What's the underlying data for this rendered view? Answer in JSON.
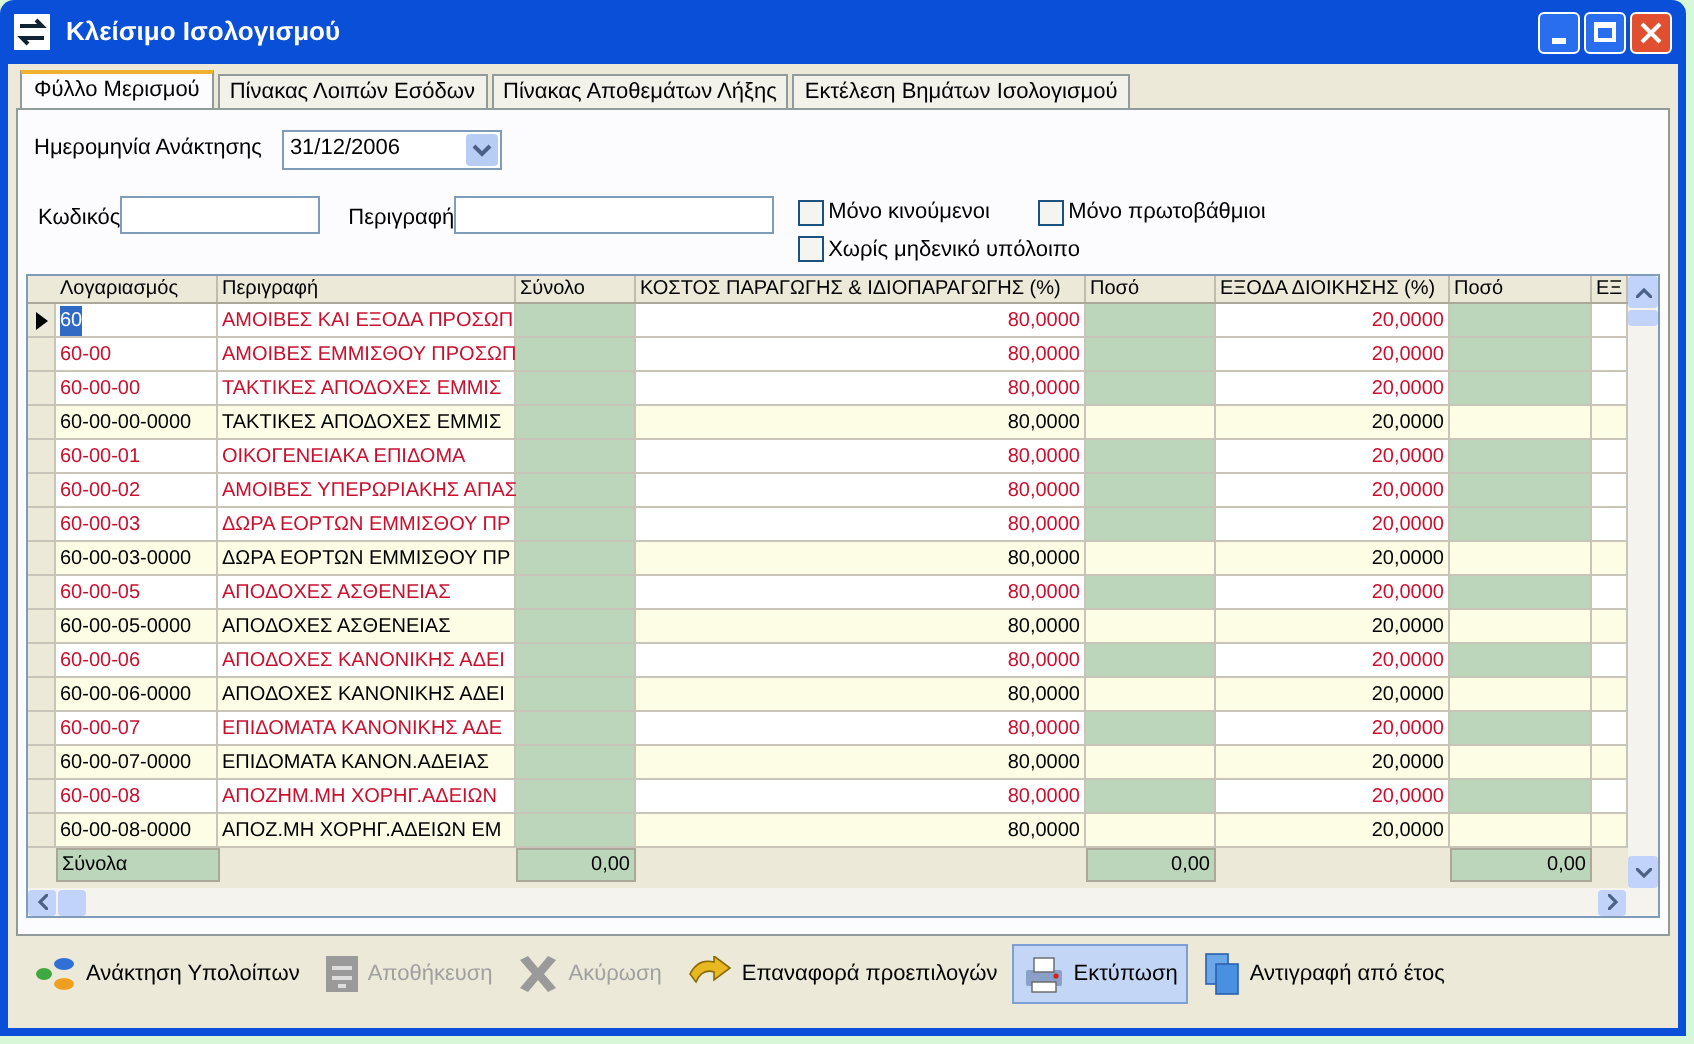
{
  "window": {
    "title": "Κλείσιμο Ισολογισμού"
  },
  "tabs": [
    {
      "label": "Φύλλο Μερισμού",
      "selected": true
    },
    {
      "label": "Πίνακας Λοιπών Εσόδων",
      "selected": false
    },
    {
      "label": "Πίνακας Αποθεμάτων Λήξης",
      "selected": false
    },
    {
      "label": "Εκτέλεση Βημάτων Ισολογισμού",
      "selected": false
    }
  ],
  "date_field": {
    "label": "Ημερομηνία Ανάκτησης",
    "value": "31/12/2006"
  },
  "filters": {
    "code_label": "Κωδικός",
    "description_label": "Περιγραφή",
    "checkboxes": [
      {
        "label": "Μόνο κινούμενοι",
        "checked": false
      },
      {
        "label": "Μόνο πρωτοβάθμιοι",
        "checked": false
      },
      {
        "label": "Χωρίς μηδενικό υπόλοιπο",
        "checked": false
      }
    ]
  },
  "table": {
    "columns": [
      "Λογαριασμός",
      "Περιγραφή",
      "Σύνολο",
      "ΚΟΣΤΟΣ ΠΑΡΑΓΩΓΗΣ & ΙΔΙΟΠΑΡΑΓΩΓΗΣ (%)",
      "Ποσό",
      "ΕΞΟΔΑ ΔΙΟΙΚΗΣΗΣ (%)",
      "Ποσό",
      "ΕΞ"
    ],
    "rows": [
      {
        "kind": "group",
        "selected": true,
        "code": "60",
        "description": "ΑΜΟΙΒΕΣ ΚΑΙ ΕΞΟΔΑ ΠΡΟΣΩΠ",
        "pct_1": "80,0000",
        "pct_2": "20,0000"
      },
      {
        "kind": "group",
        "selected": false,
        "code": "60-00",
        "description": "ΑΜΟΙΒΕΣ ΕΜΜΙΣΘΟΥ ΠΡΟΣΩΠ",
        "pct_1": "80,0000",
        "pct_2": "20,0000"
      },
      {
        "kind": "group",
        "selected": false,
        "code": "60-00-00",
        "description": "ΤΑΚΤΙΚΕΣ ΑΠΟΔΟΧΕΣ ΕΜΜΙΣ",
        "pct_1": "80,0000",
        "pct_2": "20,0000"
      },
      {
        "kind": "account",
        "selected": false,
        "code": "60-00-00-0000",
        "description": "ΤΑΚΤΙΚΕΣ ΑΠΟΔΟΧΕΣ ΕΜΜΙΣ",
        "pct_1": "80,0000",
        "pct_2": "20,0000"
      },
      {
        "kind": "group",
        "selected": false,
        "code": "60-00-01",
        "description": "ΟΙΚΟΓΕΝΕΙΑΚΑ ΕΠΙΔΟΜΑ",
        "pct_1": "80,0000",
        "pct_2": "20,0000"
      },
      {
        "kind": "group",
        "selected": false,
        "code": "60-00-02",
        "description": "ΑΜΟΙΒΕΣ ΥΠΕΡΩΡΙΑΚΗΣ ΑΠΑΣ",
        "pct_1": "80,0000",
        "pct_2": "20,0000"
      },
      {
        "kind": "group",
        "selected": false,
        "code": "60-00-03",
        "description": "ΔΩΡΑ ΕΟΡΤΩΝ ΕΜΜΙΣΘΟΥ ΠΡ",
        "pct_1": "80,0000",
        "pct_2": "20,0000"
      },
      {
        "kind": "account",
        "selected": false,
        "code": "60-00-03-0000",
        "description": "ΔΩΡΑ ΕΟΡΤΩΝ ΕΜΜΙΣΘΟΥ ΠΡ",
        "pct_1": "80,0000",
        "pct_2": "20,0000"
      },
      {
        "kind": "group",
        "selected": false,
        "code": "60-00-05",
        "description": "ΑΠΟΔΟΧΕΣ ΑΣΘΕΝΕΙΑΣ",
        "pct_1": "80,0000",
        "pct_2": "20,0000"
      },
      {
        "kind": "account",
        "selected": false,
        "code": "60-00-05-0000",
        "description": "ΑΠΟΔΟΧΕΣ ΑΣΘΕΝΕΙΑΣ",
        "pct_1": "80,0000",
        "pct_2": "20,0000"
      },
      {
        "kind": "group",
        "selected": false,
        "code": "60-00-06",
        "description": "ΑΠΟΔΟΧΕΣ ΚΑΝΟΝΙΚΗΣ ΑΔΕΙ",
        "pct_1": "80,0000",
        "pct_2": "20,0000"
      },
      {
        "kind": "account",
        "selected": false,
        "code": "60-00-06-0000",
        "description": "ΑΠΟΔΟΧΕΣ ΚΑΝΟΝΙΚΗΣ ΑΔΕΙ",
        "pct_1": "80,0000",
        "pct_2": "20,0000"
      },
      {
        "kind": "group",
        "selected": false,
        "code": "60-00-07",
        "description": "ΕΠΙΔΟΜΑΤΑ ΚΑΝΟΝΙΚΗΣ ΑΔΕ",
        "pct_1": "80,0000",
        "pct_2": "20,0000"
      },
      {
        "kind": "account",
        "selected": false,
        "code": "60-00-07-0000",
        "description": "ΕΠΙΔΟΜΑΤΑ ΚΑΝΟΝ.ΑΔΕΙΑΣ",
        "pct_1": "80,0000",
        "pct_2": "20,0000"
      },
      {
        "kind": "group",
        "selected": false,
        "code": "60-00-08",
        "description": "ΑΠΟΖΗΜ.ΜΗ ΧΟΡΗΓ.ΑΔΕΙΩΝ",
        "pct_1": "80,0000",
        "pct_2": "20,0000"
      },
      {
        "kind": "account",
        "selected": false,
        "code": "60-00-08-0000",
        "description": "ΑΠΟΖ.ΜΗ ΧΟΡΗΓ.ΑΔΕΙΩΝ ΕΜ",
        "pct_1": "80,0000",
        "pct_2": "20,0000"
      }
    ],
    "totals": {
      "label": "Σύνολα",
      "total": "0,00",
      "amount_1": "0,00",
      "amount_2": "0,00"
    }
  },
  "toolbar": [
    {
      "kind": "retrieve",
      "label": "Ανάκτηση Υπολοίπων",
      "disabled": false,
      "selected": false
    },
    {
      "kind": "save",
      "label": "Αποθήκευση",
      "disabled": true,
      "selected": false
    },
    {
      "kind": "cancel",
      "label": "Ακύρωση",
      "disabled": true,
      "selected": false
    },
    {
      "kind": "reset",
      "label": "Επαναφορά προεπιλογών",
      "disabled": false,
      "selected": false
    },
    {
      "kind": "print",
      "label": "Εκτύπωση",
      "disabled": false,
      "selected": true
    },
    {
      "kind": "copy",
      "label": "Αντιγραφή από έτος",
      "disabled": false,
      "selected": false
    }
  ]
}
